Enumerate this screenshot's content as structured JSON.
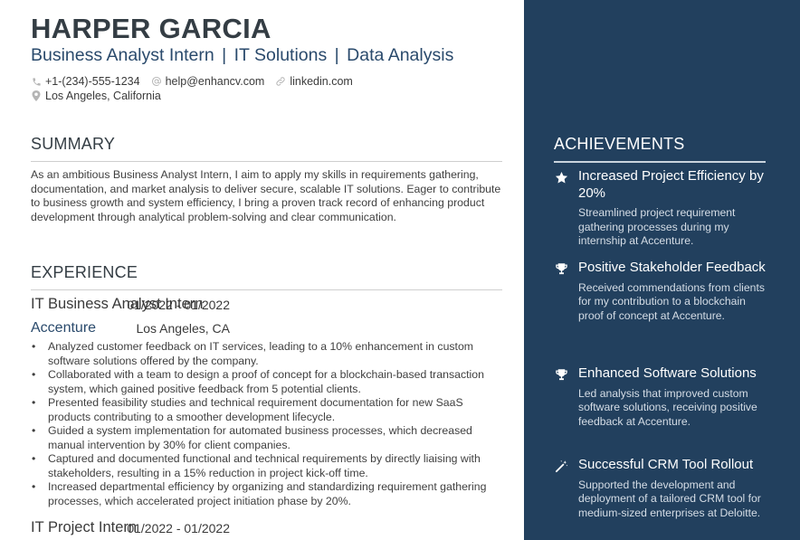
{
  "header": {
    "name": "HARPER GARCIA",
    "headline_parts": [
      "Business Analyst Intern",
      "IT Solutions",
      "Data Analysis"
    ],
    "headline_separator": "|",
    "contacts": {
      "phone": {
        "icon": "phone-icon",
        "value": "+1-(234)-555-1234"
      },
      "email": {
        "icon": "at-icon",
        "value": "help@enhancv.com"
      },
      "link": {
        "icon": "link-icon",
        "value": "linkedin.com"
      },
      "location": {
        "icon": "map-pin-icon",
        "value": "Los Angeles, California"
      }
    }
  },
  "summary": {
    "title": "SUMMARY",
    "text": "As an ambitious Business Analyst Intern, I aim to apply my skills in requirements gathering, documentation, and market analysis to deliver secure, scalable IT solutions. Eager to contribute to business growth and system efficiency, I bring a proven track record of enhancing product development through analytical problem-solving and clear communication."
  },
  "experience": {
    "title": "EXPERIENCE",
    "jobs": [
      {
        "role": "IT Business Analyst Intern",
        "dates": "01/2022 - 01/2022",
        "company": "Accenture",
        "location": "Los Angeles, CA",
        "bullet_char": "•",
        "bullets": [
          "Analyzed customer feedback on IT services, leading to a 10% enhancement in custom software solutions offered by the company.",
          "Collaborated with a team to design a proof of concept for a blockchain-based transaction system, which gained positive feedback from 5 potential clients.",
          "Presented feasibility studies and technical requirement documentation for new SaaS products contributing to a smoother development lifecycle.",
          "Guided a system implementation for automated business processes, which decreased manual intervention by 30% for client companies.",
          "Captured and documented functional and technical requirements by directly liaising with stakeholders, resulting in a 15% reduction in project kick-off time.",
          "Increased departmental efficiency by organizing and standardizing requirement gathering processes, which accelerated project initiation phase by 20%."
        ]
      },
      {
        "role": "IT Project Intern",
        "dates": "01/2022 - 01/2022"
      }
    ]
  },
  "achievements": {
    "title": "ACHIEVEMENTS",
    "items": [
      {
        "icon": "star-icon",
        "title": "Increased Project Efficiency by 20%",
        "description": "Streamlined project requirement gathering processes during my internship at Accenture."
      },
      {
        "icon": "trophy-icon",
        "title": "Positive Stakeholder Feedback",
        "description": "Received commendations from clients for my contribution to a blockchain proof of concept at Accenture."
      },
      {
        "icon": "trophy-icon",
        "title": "Enhanced Software Solutions",
        "description": "Led analysis that improved custom software solutions, receiving positive feedback at Accenture."
      },
      {
        "icon": "magic-wand-icon",
        "title": "Successful CRM Tool Rollout",
        "description": "Supported the development and deployment of a tailored CRM tool for medium-sized enterprises at Deloitte."
      }
    ]
  },
  "colors": {
    "sidebar_bg": "#22405e",
    "accent": "#2a4a6c",
    "name": "#343d44",
    "body_text": "#3f3f3f",
    "icon_muted": "#b5b5b5"
  }
}
